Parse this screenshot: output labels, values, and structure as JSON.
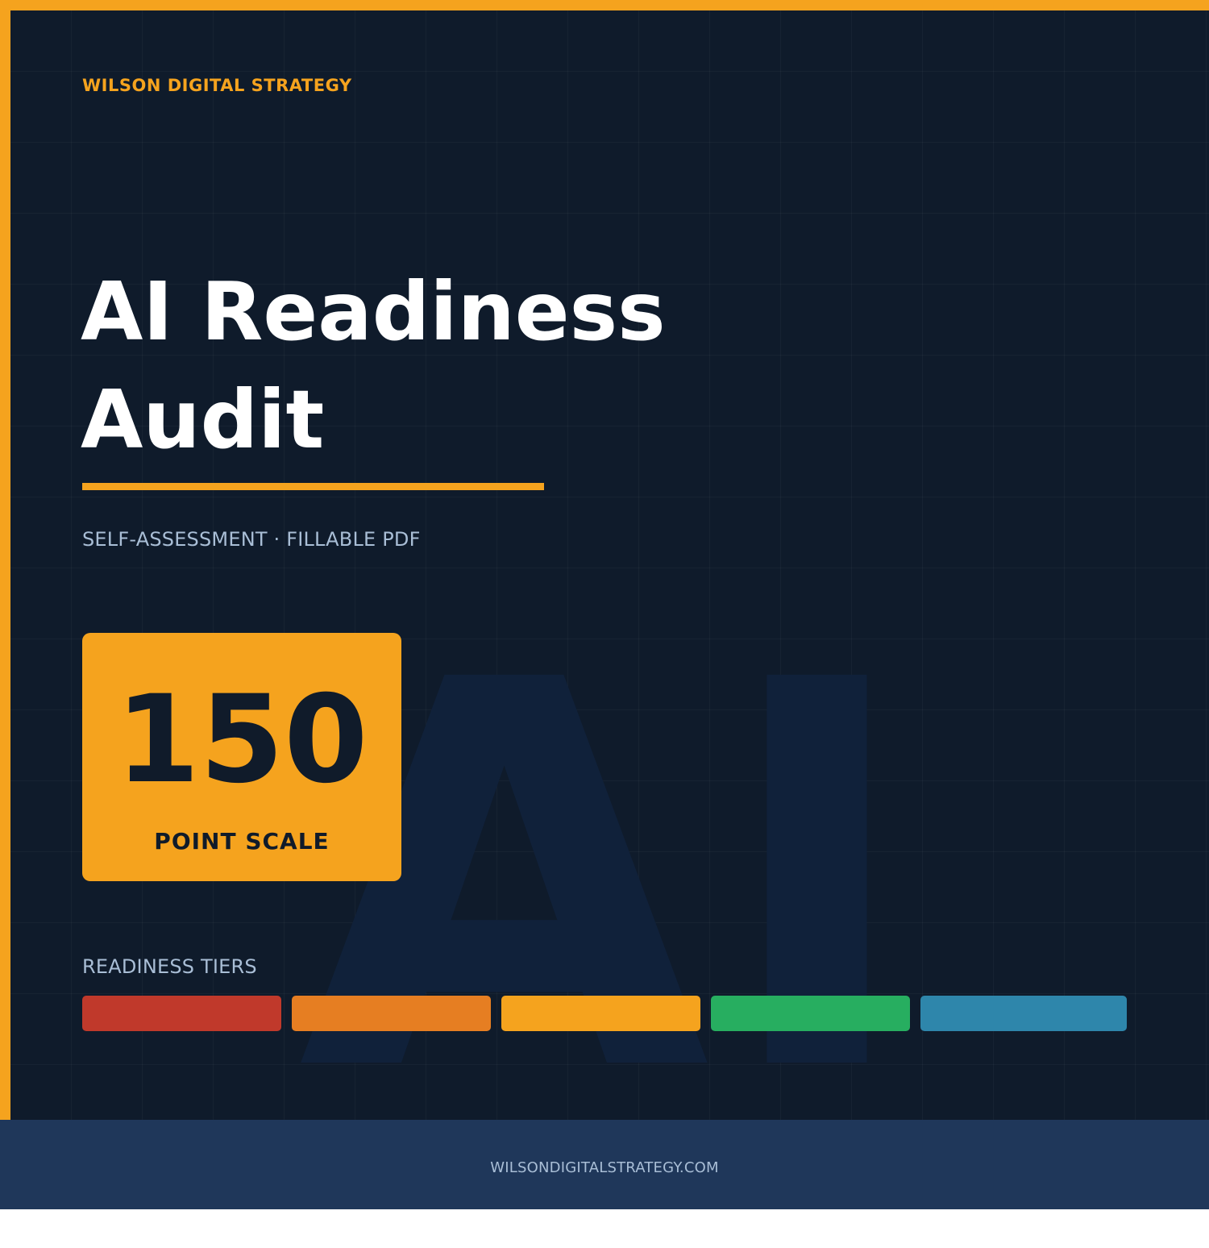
{
  "brand": "WILSON DIGITAL STRATEGY",
  "title": {
    "line1": "AI Readiness",
    "line2": "Audit"
  },
  "subtitle": "SELF-ASSESSMENT · FILLABLE PDF",
  "watermark": "AI",
  "score": {
    "value": "150",
    "label": "POINT SCALE"
  },
  "tiers": {
    "label": "READINESS TIERS",
    "colors": [
      "#c0392b",
      "#e67e22",
      "#f5a31e",
      "#27ae60",
      "#2e86ab"
    ]
  },
  "footer": {
    "url": "WILSONDIGITALSTRATEGY.COM"
  },
  "theme": {
    "accent": "#f5a31e",
    "background": "#0f1b2b",
    "footer_background": "#1f375a",
    "muted_text": "#a9bed6"
  }
}
